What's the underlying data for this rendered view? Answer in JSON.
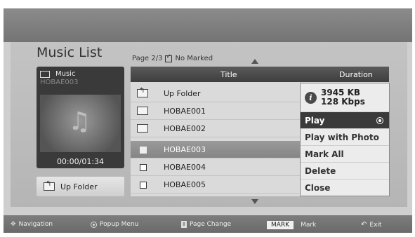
{
  "header": {
    "title": "Music List"
  },
  "page_info": {
    "page": "Page 2/3",
    "marked": "No Marked"
  },
  "preview": {
    "type_label": "Music",
    "file_name": "HOBAE003",
    "time": "00:00/01:34"
  },
  "up_folder_button": "Up Folder",
  "list": {
    "columns": {
      "title": "Title",
      "duration": "Duration"
    },
    "rows": [
      {
        "label": "Up Folder",
        "icon": "up-folder-icon"
      },
      {
        "label": "HOBAE001",
        "icon": "folder-icon"
      },
      {
        "label": "HOBAE002",
        "icon": "folder-icon"
      },
      {
        "label": "HOBAE003",
        "icon": "checkbox-icon",
        "selected": true
      },
      {
        "label": "HOBAE004",
        "icon": "checkbox-icon"
      },
      {
        "label": "HOBAE005",
        "icon": "checkbox-icon"
      }
    ]
  },
  "popup": {
    "size": "3945 KB",
    "bitrate": "128 Kbps",
    "items": [
      "Play",
      "Play with Photo",
      "Mark All",
      "Delete",
      "Close"
    ],
    "selected": "Play"
  },
  "bottom_bar": {
    "navigation": "Navigation",
    "popup_menu": "Popup Menu",
    "page_change": "Page Change",
    "mark_key": "MARK",
    "mark": "Mark",
    "exit": "Exit"
  },
  "colors": {
    "selected_row": "#8f8f8f",
    "popup_selected": "#3a3a3a",
    "header_bar": "#4a4a4a"
  }
}
